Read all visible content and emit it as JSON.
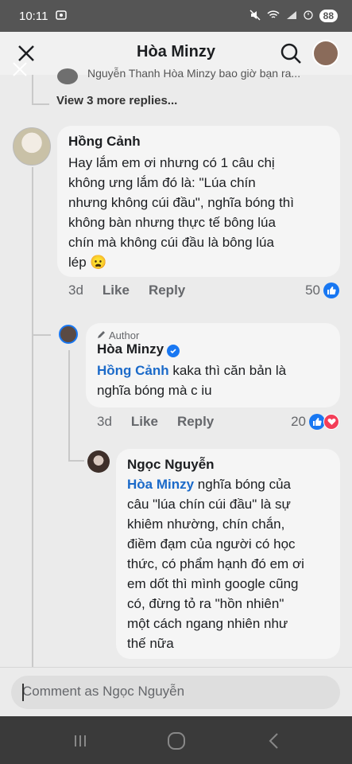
{
  "status_bar": {
    "time": "10:11",
    "battery": "88"
  },
  "header": {
    "title": "Hòa Minzy"
  },
  "previous_reply": {
    "text": "Nguyễn Thanh  Hòa Minzy bao giờ bạn ra..."
  },
  "view_more": "View 3 more replies...",
  "comments": [
    {
      "name": "Hồng Cảnh",
      "text": "Hay lắm em ơi nhưng có 1 câu chị không ưng lắm đó là: \"Lúa chín nhưng không cúi đầu\", nghĩa bóng thì không bàn nhưng thực tế bông lúa chín mà không cúi đầu là bông lúa lép 😦",
      "line1": "Hay lắm em ơi nhưng có 1 câu chị",
      "line2": "không ưng lắm đó là: \"Lúa chín",
      "line3": "nhưng không cúi đầu\", nghĩa bóng thì",
      "line4": "không bàn nhưng thực tế bông lúa",
      "line5": "chín mà không cúi đầu là bông lúa",
      "line6": "lép",
      "time": "3d",
      "like": "Like",
      "reply": "Reply",
      "reactions": "50"
    },
    {
      "author_tag": "Author",
      "name": "Hòa Minzy",
      "mention": "Hồng Cảnh",
      "text_a": "kaka thì căn bản là",
      "text_b": "nghĩa bóng mà c iu",
      "time": "3d",
      "like": "Like",
      "reply": "Reply",
      "reactions": "20"
    },
    {
      "name": "Ngọc Nguyễn",
      "mention": "Hòa Minzy",
      "text_a": "nghĩa bóng của",
      "lines": [
        "câu \"lúa chín cúi đầu\" là sự",
        "khiêm nhường, chín chắn,",
        "điềm đạm của người có học",
        "thức, có phẩm hạnh đó em ơi",
        "em dốt thì mình google cũng",
        "có, đừng tỏ ra \"hồn nhiên\"",
        "một cách ngang nhiên như",
        "thế nữa"
      ]
    }
  ],
  "composer": {
    "placeholder": "Comment as Ngọc Nguyễn"
  },
  "colors": {
    "like_blue": "#1877f2",
    "heart_red": "#f33e58",
    "mention_blue": "#1b6ac9"
  }
}
